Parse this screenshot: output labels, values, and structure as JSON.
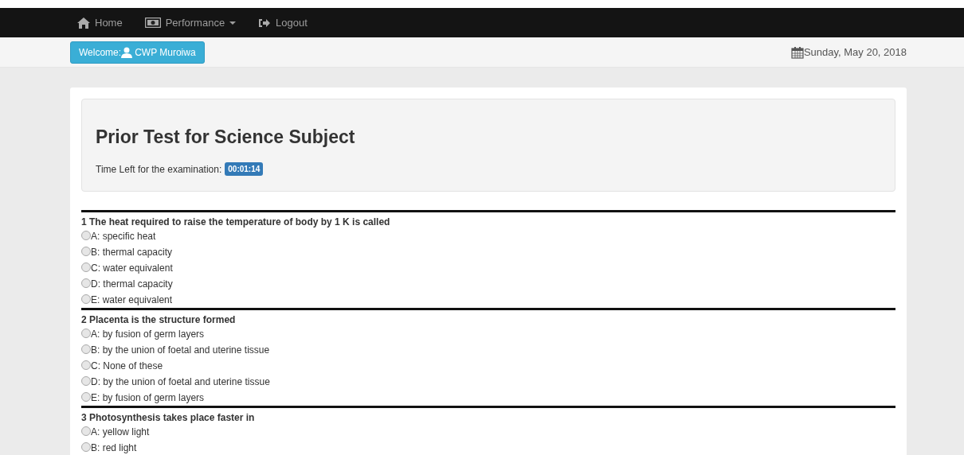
{
  "navbar": {
    "items": [
      {
        "kind": "home",
        "label": "Home"
      },
      {
        "kind": "performance",
        "label": "Performance"
      },
      {
        "kind": "logout",
        "label": "Logout"
      }
    ]
  },
  "welcome": {
    "prefix": "Welcome:",
    "user": "CWP Muroiwa"
  },
  "date": "Sunday, May 20, 2018",
  "exam": {
    "title": "Prior Test for Science Subject",
    "timer_label": "Time Left for the examination:",
    "timer": "00:01:14"
  },
  "questions": [
    {
      "text": "1 The heat required to raise the temperature of body by 1 K is called",
      "options": [
        {
          "label": "A: specific heat",
          "selected": false
        },
        {
          "label": "B: thermal capacity",
          "selected": false
        },
        {
          "label": "C: water equivalent",
          "selected": false
        },
        {
          "label": "D: thermal capacity",
          "selected": false
        },
        {
          "label": "E: water equivalent",
          "selected": false
        }
      ]
    },
    {
      "text": "2 Placenta is the structure formed",
      "options": [
        {
          "label": "A: by fusion of germ layers",
          "selected": false
        },
        {
          "label": "B: by the union of foetal and uterine tissue",
          "selected": false
        },
        {
          "label": "C: None of these",
          "selected": false
        },
        {
          "label": "D: by the union of foetal and uterine tissue",
          "selected": false
        },
        {
          "label": "E: by fusion of germ layers",
          "selected": false
        }
      ]
    },
    {
      "text": "3 Photosynthesis takes place faster in",
      "options": [
        {
          "label": "A: yellow light",
          "selected": false
        },
        {
          "label": "B: red light",
          "selected": false
        }
      ]
    }
  ]
}
